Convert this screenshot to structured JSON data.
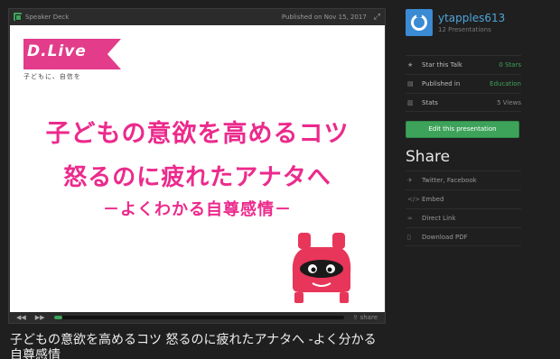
{
  "player": {
    "brand": "Speaker Deck",
    "published": "Published on Nov 15, 2017",
    "share_label": "share"
  },
  "slide": {
    "logo_text": "D.Live",
    "logo_sub": "子どもに、自信を",
    "line1": "子どもの意欲を高めるコツ",
    "line2": "怒るのに疲れたアナタへ",
    "line3": "－よくわかる自尊感情－"
  },
  "progress": 0.01,
  "talk_title": "子どもの意欲を高めるコツ 怒るのに疲れたアナタへ -よく分かる自尊感情",
  "sidebar": {
    "user_name": "ytapples613",
    "user_presentations": "12 Presentations",
    "stats": [
      {
        "icon": "star-icon",
        "label": "Star this Talk",
        "value": "0 Stars"
      },
      {
        "icon": "folder-icon",
        "label": "Published in",
        "value": "Education"
      },
      {
        "icon": "chart-icon",
        "label": "Stats",
        "value": "5 Views"
      }
    ],
    "edit_button": "Edit this presentation",
    "share_heading": "Share",
    "share_items": [
      {
        "icon": "bird-icon",
        "label": "Twitter, Facebook"
      },
      {
        "icon": "code-icon",
        "label": "Embed"
      },
      {
        "icon": "link-icon",
        "label": "Direct Link"
      },
      {
        "icon": "download-icon",
        "label": "Download PDF"
      }
    ]
  },
  "colors": {
    "accent_green": "#3ea35a",
    "slide_pink": "#ec2a8c",
    "link_blue": "#4fa4d8"
  }
}
